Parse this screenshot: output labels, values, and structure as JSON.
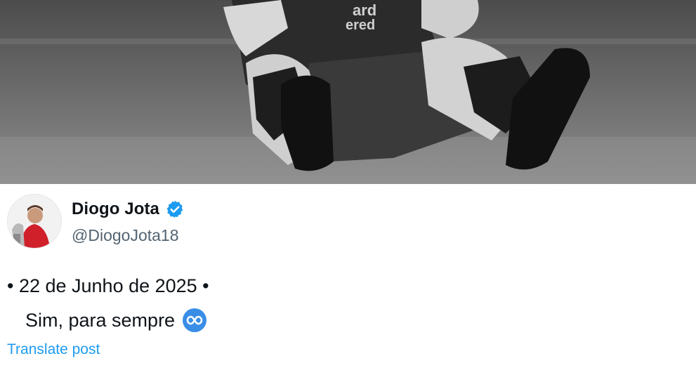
{
  "post": {
    "author": {
      "display_name": "Diogo Jota",
      "handle": "@DiogoJota18",
      "verified": true
    },
    "text_line1": "• 22 de Junho de 2025 •",
    "text_line2": "Sim, para sempre",
    "emoji": "infinity-icon",
    "translate_label": "Translate post"
  },
  "colors": {
    "text_primary": "#0f1419",
    "text_secondary": "#536471",
    "link": "#1d9bf0",
    "verified_badge": "#1d9bf0",
    "photo_tone": "grayscale"
  }
}
